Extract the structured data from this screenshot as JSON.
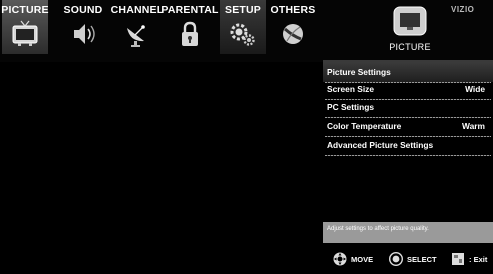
{
  "menu": {
    "tabs": [
      {
        "label": "PICTURE",
        "icon": "tv-icon"
      },
      {
        "label": "SOUND",
        "icon": "speaker-icon"
      },
      {
        "label": "CHANNEL",
        "icon": "satellite-dish-icon"
      },
      {
        "label": "PARENTAL",
        "icon": "padlock-icon"
      },
      {
        "label": "SETUP",
        "icon": "gears-icon"
      },
      {
        "label": "OTHERS",
        "icon": "ball-icon"
      }
    ],
    "selected_index": 0,
    "highlight_index": 4
  },
  "brand": "VIZIO",
  "page": {
    "title": "PICTURE",
    "icon": "picture-icon"
  },
  "settings": [
    {
      "label": "Picture Settings",
      "value": ""
    },
    {
      "label": "Screen Size",
      "value": "Wide"
    },
    {
      "label": "PC Settings",
      "value": ""
    },
    {
      "label": "Color Temperature",
      "value": "Warm"
    },
    {
      "label": "Advanced Picture Settings",
      "value": ""
    }
  ],
  "help_text": "Adjust settings to affect picture quality.",
  "footer": {
    "move": "MOVE",
    "select": "SELECT",
    "exit": ": Exit"
  },
  "colors": {
    "background": "#000000",
    "help_bar": "#9a9a9a",
    "selected_tab": "#4a4a4a"
  }
}
